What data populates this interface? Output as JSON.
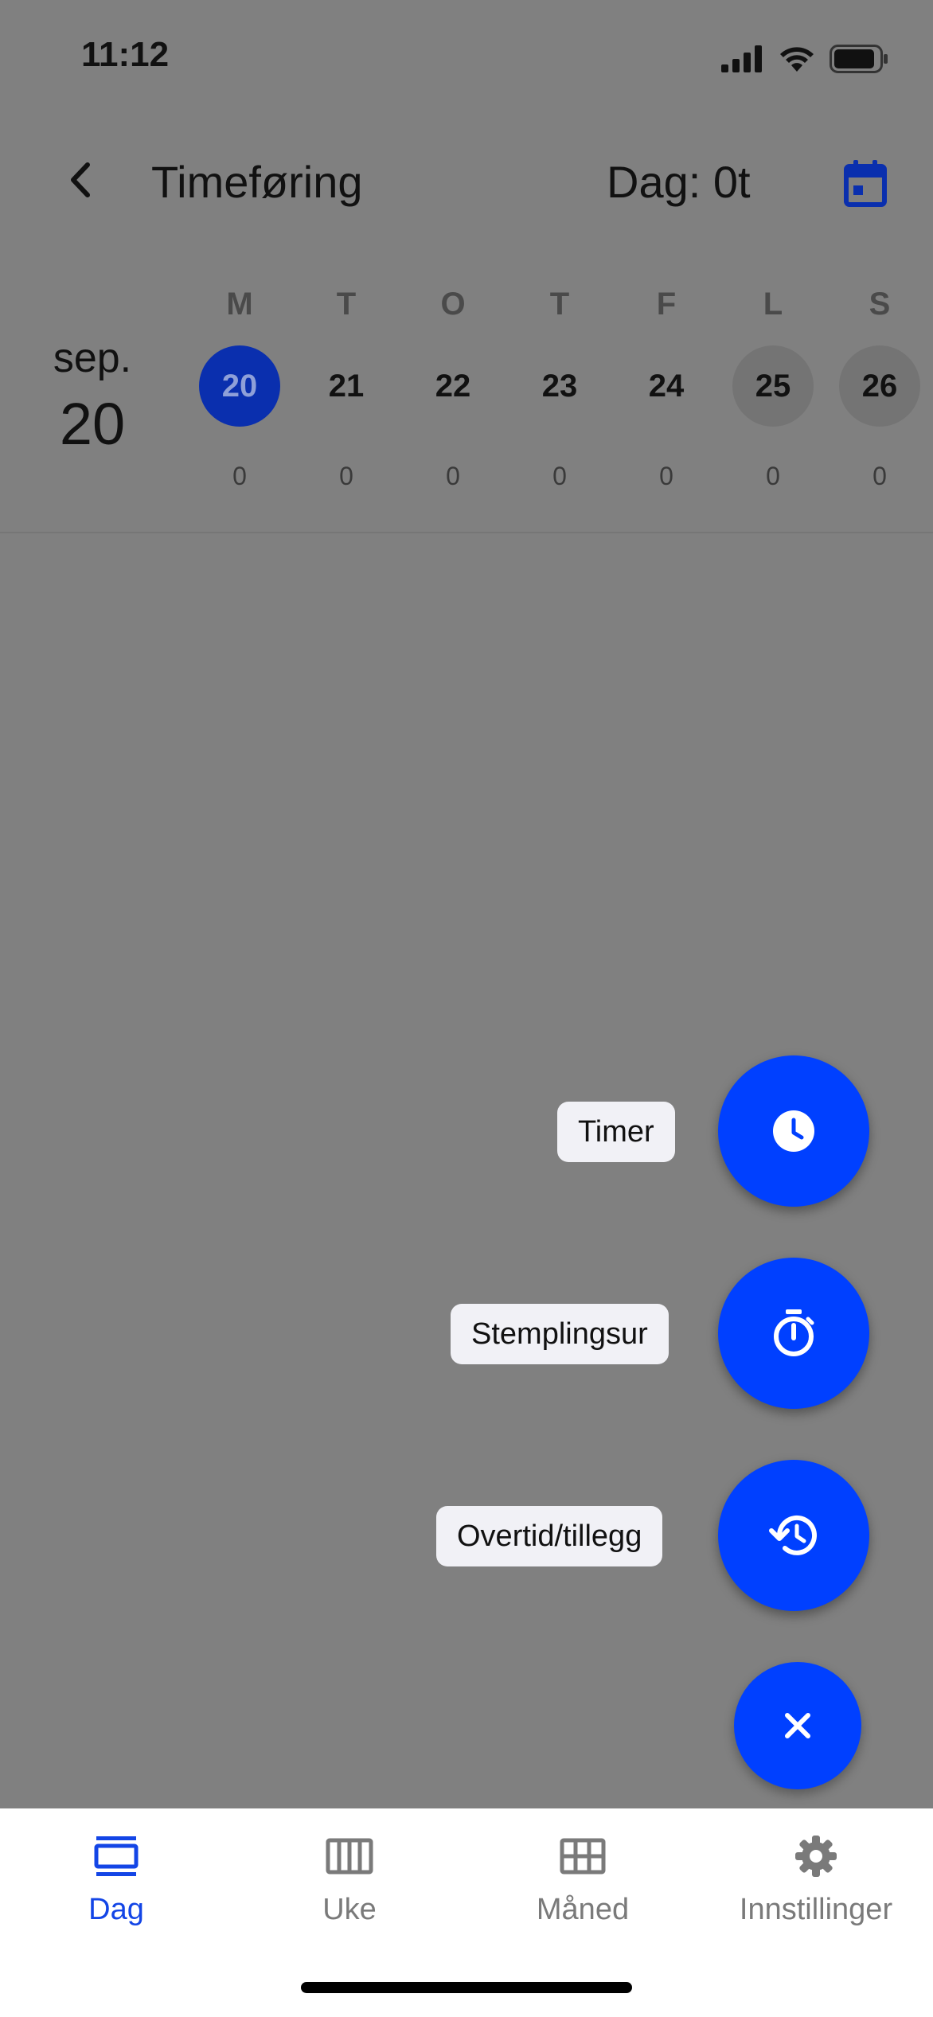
{
  "status_bar": {
    "time": "11:12"
  },
  "header": {
    "title": "Timeføring",
    "day_total": "Dag: 0t"
  },
  "date": {
    "month": "sep.",
    "day": "20"
  },
  "week": [
    {
      "letter": "M",
      "date": "20",
      "hours": "0",
      "selected": true
    },
    {
      "letter": "T",
      "date": "21",
      "hours": "0"
    },
    {
      "letter": "O",
      "date": "22",
      "hours": "0"
    },
    {
      "letter": "T",
      "date": "23",
      "hours": "0"
    },
    {
      "letter": "F",
      "date": "24",
      "hours": "0"
    },
    {
      "letter": "L",
      "date": "25",
      "hours": "0",
      "weekend": true
    },
    {
      "letter": "S",
      "date": "26",
      "hours": "0",
      "weekend": true
    }
  ],
  "fab_menu": {
    "items": [
      {
        "label": "Timer",
        "icon": "clock-icon"
      },
      {
        "label": "Stemplingsur",
        "icon": "stopwatch-icon"
      },
      {
        "label": "Overtid/tillegg",
        "icon": "history-icon"
      }
    ],
    "close_icon": "close-icon"
  },
  "bottom_nav": {
    "items": [
      {
        "label": "Dag",
        "icon": "day-view-icon",
        "active": true
      },
      {
        "label": "Uke",
        "icon": "week-view-icon"
      },
      {
        "label": "Måned",
        "icon": "month-grid-icon"
      },
      {
        "label": "Innstillinger",
        "icon": "gear-icon"
      }
    ]
  },
  "colors": {
    "accent": "#0040ff",
    "selected_day": "#0a2fae",
    "overlay": "#808080",
    "nav_active": "#1345e6"
  }
}
